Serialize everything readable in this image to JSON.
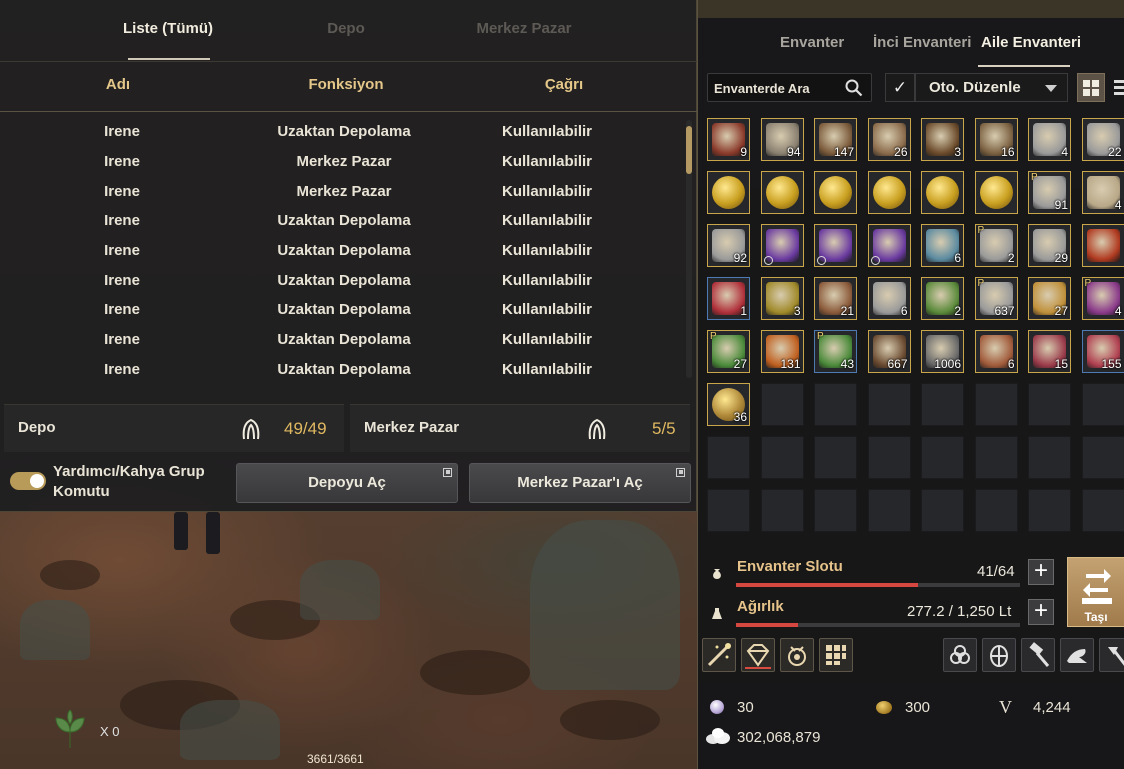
{
  "storage": {
    "tabs": [
      "Liste (Tümü)",
      "Depo",
      "Merkez Pazar"
    ],
    "columns": [
      "Adı",
      "Fonksiyon",
      "Çağrı"
    ],
    "rows": [
      {
        "name": "Irene",
        "function": "Uzaktan Depolama",
        "call": "Kullanılabilir"
      },
      {
        "name": "Irene",
        "function": "Merkez Pazar",
        "call": "Kullanılabilir"
      },
      {
        "name": "Irene",
        "function": "Merkez Pazar",
        "call": "Kullanılabilir"
      },
      {
        "name": "Irene",
        "function": "Uzaktan Depolama",
        "call": "Kullanılabilir"
      },
      {
        "name": "Irene",
        "function": "Uzaktan Depolama",
        "call": "Kullanılabilir"
      },
      {
        "name": "Irene",
        "function": "Uzaktan Depolama",
        "call": "Kullanılabilir"
      },
      {
        "name": "Irene",
        "function": "Uzaktan Depolama",
        "call": "Kullanılabilir"
      },
      {
        "name": "Irene",
        "function": "Uzaktan Depolama",
        "call": "Kullanılabilir"
      },
      {
        "name": "Irene",
        "function": "Uzaktan Depolama",
        "call": "Kullanılabilir"
      }
    ],
    "depo_label": "Depo",
    "depo_value": "49/49",
    "market_label": "Merkez Pazar",
    "market_value": "5/5",
    "toggle_label": "Yardımcı/Kahya Grup Komutu",
    "toggle_on": true,
    "open_depot_button": "Depoyu Aç",
    "open_market_button": "Merkez Pazar'ı Aç",
    "scroll_position": 0.05
  },
  "inventory": {
    "tabs": [
      "Envanter",
      "İnci Envanteri",
      "Aile Envanteri"
    ],
    "active_tab": "Aile Envanteri",
    "search_placeholder": "Envanterde Ara",
    "auto_sort_label": "Oto. Düzenle",
    "auto_sort_checked": true,
    "slots": [
      {
        "count": "9",
        "icon": "food-icon",
        "hue": "#8a3a2a"
      },
      {
        "count": "94",
        "icon": "food-icon",
        "hue": "#8a8070"
      },
      {
        "count": "147",
        "icon": "food-icon",
        "hue": "#7a5a3a"
      },
      {
        "count": "26",
        "icon": "food-icon",
        "hue": "#8a6a4a"
      },
      {
        "count": "3",
        "icon": "food-icon",
        "hue": "#6a4a2a"
      },
      {
        "count": "16",
        "icon": "soup-icon",
        "hue": "#7a6040"
      },
      {
        "count": "4",
        "icon": "scroll-icon",
        "hue": "#9a9a9a"
      },
      {
        "count": "22",
        "icon": "scroll-icon",
        "hue": "#9a9a9a"
      },
      {
        "count": "",
        "icon": "gold-coin-icon",
        "hue": "#c9a020"
      },
      {
        "count": "",
        "icon": "gold-coin-icon",
        "hue": "#c9a020"
      },
      {
        "count": "",
        "icon": "gold-coin-icon",
        "hue": "#c9a020"
      },
      {
        "count": "",
        "icon": "gold-coin-icon",
        "hue": "#c9a020"
      },
      {
        "count": "",
        "icon": "gold-coin-icon",
        "hue": "#c9a020"
      },
      {
        "count": "",
        "icon": "gold-coin-icon",
        "hue": "#c9a020"
      },
      {
        "count": "91",
        "icon": "scroll-icon",
        "hue": "#9a9a9a",
        "p": true
      },
      {
        "count": "4",
        "icon": "letter-icon",
        "hue": "#b8a888"
      },
      {
        "count": "92",
        "icon": "scroll-icon",
        "hue": "#9a9a9a"
      },
      {
        "count": "",
        "icon": "magic-scroll-icon",
        "hue": "#6a3aa0",
        "clock": true
      },
      {
        "count": "",
        "icon": "magic-scroll-icon",
        "hue": "#6a3aa0",
        "clock": true
      },
      {
        "count": "",
        "icon": "magic-scroll-icon",
        "hue": "#6a3aa0",
        "clock": true
      },
      {
        "count": "6",
        "icon": "scroll-icon",
        "hue": "#5a8aa0"
      },
      {
        "count": "2",
        "icon": "scroll-icon",
        "hue": "#9a9a9a",
        "p": true
      },
      {
        "count": "29",
        "icon": "scroll-icon",
        "hue": "#9a9a9a"
      },
      {
        "count": "",
        "icon": "potion-icon",
        "hue": "#b03a20"
      },
      {
        "count": "1",
        "icon": "crystal-icon",
        "hue": "#b0303a",
        "blue": true
      },
      {
        "count": "3",
        "icon": "flask-icon",
        "hue": "#a08a2a"
      },
      {
        "count": "21",
        "icon": "tea-icon",
        "hue": "#8a5a3a"
      },
      {
        "count": "6",
        "icon": "scroll-icon",
        "hue": "#9a9a9a"
      },
      {
        "count": "2",
        "icon": "herb-icon",
        "hue": "#5a8a3a"
      },
      {
        "count": "637",
        "icon": "scroll-icon",
        "hue": "#9a9a9a",
        "p": true
      },
      {
        "count": "27",
        "icon": "book-icon",
        "hue": "#c0903a"
      },
      {
        "count": "4",
        "icon": "vase-icon",
        "hue": "#8a3a8a",
        "p": true
      },
      {
        "count": "27",
        "icon": "vase-icon",
        "hue": "#4a8a3a",
        "p": true
      },
      {
        "count": "131",
        "icon": "carrot-icon",
        "hue": "#c06020"
      },
      {
        "count": "43",
        "icon": "vase-icon",
        "hue": "#4a8a3a",
        "p": true,
        "blue": true
      },
      {
        "count": "667",
        "icon": "wood-icon",
        "hue": "#6a4a30"
      },
      {
        "count": "1006",
        "icon": "ore-icon",
        "hue": "#6a6a6a"
      },
      {
        "count": "6",
        "icon": "ore-icon",
        "hue": "#a05a3a"
      },
      {
        "count": "15",
        "icon": "crystal-icon",
        "hue": "#9a3a4a"
      },
      {
        "count": "155",
        "icon": "crystal-icon",
        "hue": "#b04050",
        "blue": true
      },
      {
        "count": "36",
        "icon": "coin-icon",
        "hue": "#b08a3a"
      }
    ],
    "total_slots": 64,
    "slot_label": "Envanter Slotu",
    "slot_value": "41/64",
    "slot_fraction": 0.64,
    "weight_label": "Ağırlık",
    "weight_value": "277.2 / 1,250 Lt",
    "weight_fraction": 0.22,
    "move_button": "Taşı",
    "pearls": "30",
    "coins": "300",
    "v_label": "V",
    "v_value": "4,244",
    "silver": "302,068,879"
  },
  "hud": {
    "x_count": "X 0",
    "hp": "3661/3661"
  }
}
